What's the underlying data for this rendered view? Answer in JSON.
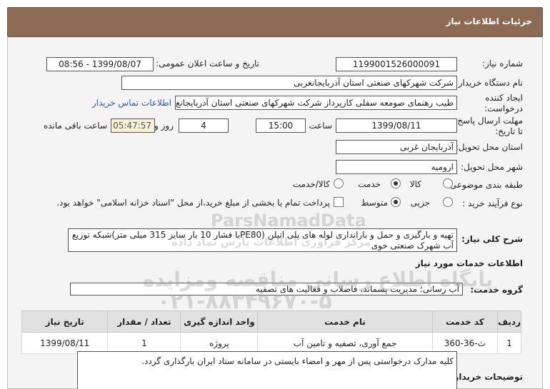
{
  "header": {
    "title": "جزئیات اطلاعات نیاز"
  },
  "fields": {
    "need_number_label": "شماره نیاز:",
    "need_number": "1199001526000091",
    "announce_label": "تاریخ و ساعت اعلان عمومی:",
    "announce_value": "1399/08/07 - 08:56",
    "buyer_label": "نام دستگاه خریدار:",
    "buyer_value": "شرکت شهرکهای صنعتی استان آذربایجانغربی",
    "creator_label_1": "ایجاد کننده",
    "creator_label_2": "درخواست:",
    "creator_value": "طیب رهنمای صومعه سفلی کارپرداز شرکت شهرکهای صنعتی استان آذربایجانغ",
    "contact_link": "اطلاعات تماس خریدار",
    "deadline_label_1": "مهلت ارسال پاسخ:",
    "deadline_label_2": "تا تاریخ:",
    "deadline_date": "1399/08/11",
    "time_label": "ساعت",
    "deadline_time": "15:00",
    "days_value": "4",
    "days_label": "روز و",
    "remaining_time": "05:47:57",
    "remaining_label": "ساعت باقی مانده",
    "province_label": "استان محل تحویل:",
    "province_value": "آذربایجان غربی",
    "city_label": "شهر محل تحویل:",
    "city_value": "ارومیه",
    "category_label": "طبقه بندی موضوعی:",
    "category_options": [
      "کالا",
      "خدمت",
      "کالا/خدمت"
    ],
    "purchase_label": "نوع فرآیند خرید :",
    "purchase_options": [
      "جزیی",
      "متوسط"
    ],
    "payment_note": "پرداخت تمام یا بخشی از مبلغ خرید،از محل \"اسناد خزانه اسلامی\" خواهد بود.",
    "summary_label": "شرح کلی نیاز:",
    "summary_value_1": "تهیه و بارگیری و حمل و بارانداری لوله های پلی اتیلن (PE80با فشار 10 بار سایز 315 میلی متر)شبکه توزیع",
    "summary_value_2": "آب شهرک صنعتی خوی",
    "services_heading": "اطلاعات خدمات مورد نیاز",
    "service_group_label": "گروه خدمت:",
    "service_group_value": "آب رسانی؛ مدیریت پسماند، فاضلاب و فعالیت های تصفیه",
    "buyer_notes_label": "توضیحات خریدار:",
    "buyer_notes_value": "کلیه مدارک درخواستی پس از مهر و امضاء بایستی در سامانه ستاد ایران بارگذاری گردد."
  },
  "table": {
    "headers": [
      "ردیف",
      "کد خدمت",
      "نام خدمت",
      "واحد اندازه گیری",
      "تعداد / مقدار",
      "تاریخ نیاز"
    ],
    "rows": [
      [
        "1",
        "ث-36-360",
        "جمع آوری، تصفیه و تامین آب",
        "پروژه",
        "1",
        "1399/08/11"
      ]
    ]
  },
  "watermarks": {
    "brand": "ParsNamadData",
    "line1": "مرکز فراوری اطلاعات پارس نماد داده",
    "line2": "پایگاه اطلاع رسانی مناقصه ومزایده",
    "phone": "۰۲۱-۸۸۳۴۹۶۷۰-۵"
  }
}
